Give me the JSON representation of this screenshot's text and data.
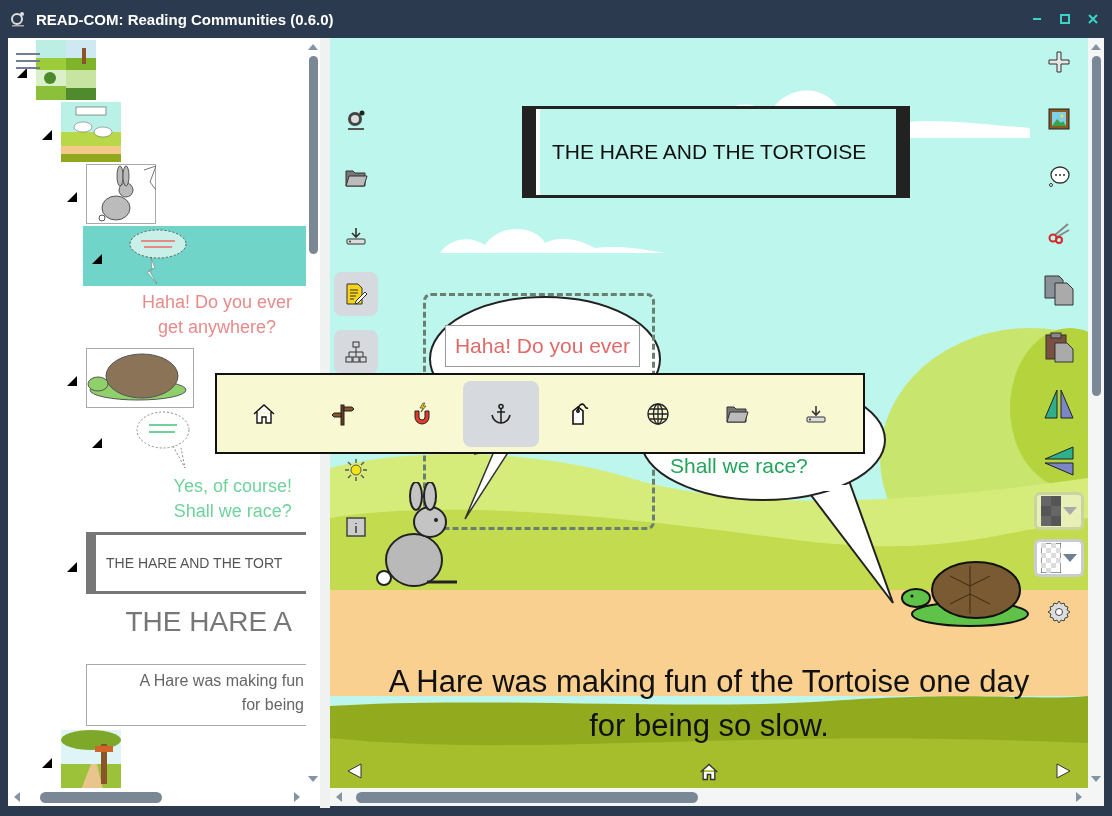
{
  "window": {
    "title": "READ-COM: Reading Communities (0.6.0)"
  },
  "tree": [
    {
      "kind": "comic-grid",
      "expanded": true,
      "selected": false,
      "children": [
        {
          "kind": "page",
          "expanded": true,
          "selected": false,
          "children": [
            {
              "kind": "hare",
              "expanded": true,
              "selected": false,
              "children": [
                {
                  "kind": "thought-bubble",
                  "expanded": true,
                  "selected": true,
                  "children": [
                    {
                      "kind": "text",
                      "text": "Haha! Do you ever\nget anywhere?",
                      "color": "#e88a8a"
                    }
                  ]
                }
              ]
            },
            {
              "kind": "turtle",
              "expanded": true,
              "selected": false,
              "children": [
                {
                  "kind": "speech-bubble",
                  "expanded": true,
                  "selected": false,
                  "children": [
                    {
                      "kind": "text",
                      "text": "Yes, of course!\nShall we race?",
                      "color": "#6fd29c"
                    }
                  ]
                }
              ]
            },
            {
              "kind": "title-box",
              "expanded": true,
              "selected": false,
              "text": "THE HARE AND THE TORT",
              "children": [
                {
                  "kind": "heading",
                  "text": "THE HARE A"
                }
              ]
            },
            {
              "kind": "narration-box",
              "selected": false,
              "text": "A Hare was making fun\nfor being"
            }
          ]
        },
        {
          "kind": "page-2",
          "expanded": true,
          "selected": false
        }
      ]
    }
  ],
  "canvas": {
    "title": "THE HARE AND THE TORTOISE",
    "bubbles": [
      {
        "kind": "thought",
        "text": "Haha! Do you ever",
        "color": "#e06a6a",
        "selected": true
      },
      {
        "kind": "speech",
        "text": "Shall we race?",
        "color": "#22a55a",
        "selected": false
      }
    ],
    "narration": "A Hare was making fun of the Tortoise one day for being so slow."
  },
  "left_tools": [
    {
      "kind": "logo",
      "on": false
    },
    {
      "kind": "folder",
      "on": false
    },
    {
      "kind": "download",
      "on": false
    },
    {
      "kind": "edit",
      "on": true
    },
    {
      "kind": "hierarchy",
      "on": true
    }
  ],
  "left_tools_lower": [
    {
      "kind": "sun",
      "on": false
    },
    {
      "kind": "info",
      "on": false
    }
  ],
  "right_tools": [
    {
      "kind": "add"
    },
    {
      "kind": "image"
    },
    {
      "kind": "comment"
    },
    {
      "kind": "cut"
    },
    {
      "kind": "copy"
    },
    {
      "kind": "paste"
    },
    {
      "kind": "flip-horizontal"
    },
    {
      "kind": "flip-vertical"
    },
    {
      "kind": "fill-color",
      "disabled": true
    },
    {
      "kind": "transparency",
      "disabled": false
    },
    {
      "kind": "settings"
    }
  ],
  "popup": [
    {
      "kind": "home",
      "selected": false
    },
    {
      "kind": "signpost",
      "selected": false
    },
    {
      "kind": "magnet",
      "selected": false
    },
    {
      "kind": "anchor",
      "selected": true
    },
    {
      "kind": "tag",
      "selected": false
    },
    {
      "kind": "globe",
      "selected": false
    },
    {
      "kind": "folder",
      "selected": false
    },
    {
      "kind": "download",
      "selected": false
    }
  ],
  "nav": [
    {
      "kind": "previous"
    },
    {
      "kind": "home"
    },
    {
      "kind": "next"
    }
  ]
}
